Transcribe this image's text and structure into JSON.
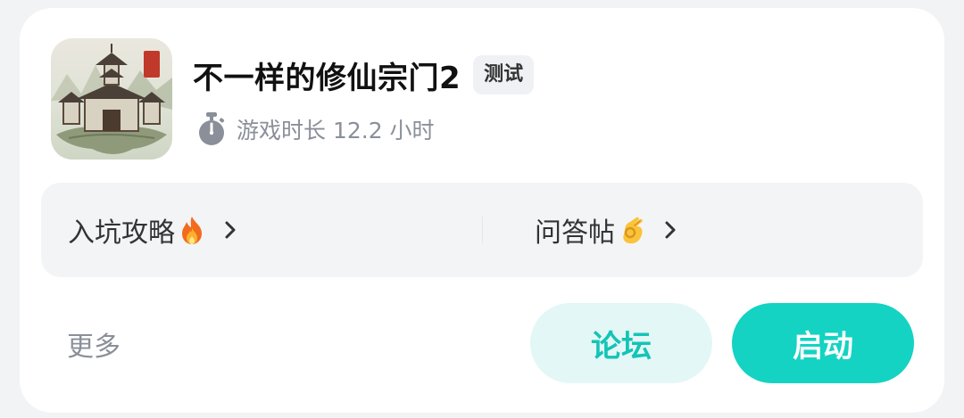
{
  "game": {
    "title": "不一样的修仙宗门2",
    "badge": "测试",
    "icon_text": "宗门",
    "playtime": "游戏时长 12.2 小时"
  },
  "links": [
    {
      "label": "入坑攻略",
      "emoji": "fire"
    },
    {
      "label": "问答帖",
      "emoji": "ok-hand"
    }
  ],
  "actions": {
    "more": "更多",
    "forum": "论坛",
    "launch": "启动"
  },
  "colors": {
    "accent": "#14d3c3",
    "accent_light": "#e3f7f6",
    "accent_text": "#14c4b6",
    "secondary_text": "#8a8f99",
    "panel_bg": "#f3f4f6"
  }
}
